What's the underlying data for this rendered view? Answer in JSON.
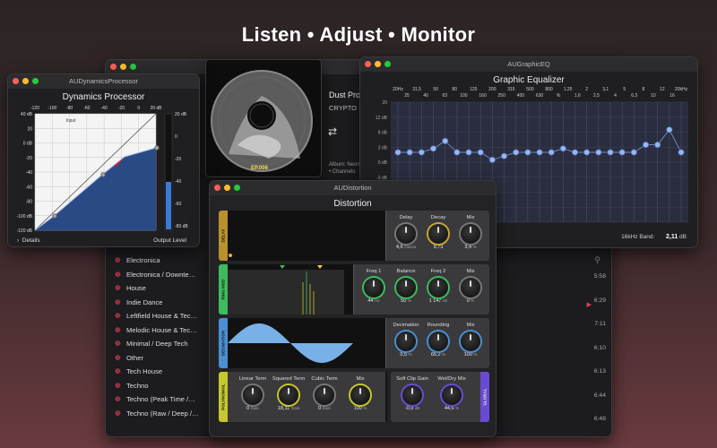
{
  "headline": "Listen • Adjust • Monitor",
  "music": {
    "genres": [
      "Electronica",
      "Electronica / Downte…",
      "House",
      "Indie Dance",
      "Leftfield House & Tec…",
      "Melodic House & Tec…",
      "Minimal / Deep Tech",
      "Other",
      "Tech House",
      "Techno",
      "Techno (Peak Time /…",
      "Techno (Raw / Deep /…"
    ],
    "times": [
      "5:58",
      "6:29",
      "7:11",
      "6:10",
      "6:13",
      "6:44",
      "6:48"
    ],
    "track_title": "Dust Pro",
    "track_artist": "CRYPTO",
    "album_line1": "Album: Neon",
    "album_line2": "• Channels:",
    "album_badge": "EP.006"
  },
  "dynamics": {
    "window_title": "AUDynamicsProcessor",
    "title": "Dynamics Processor",
    "x_ticks": [
      "-120",
      "-100",
      "-80",
      "-60",
      "-40",
      "-20",
      "0",
      "20 dB"
    ],
    "y_ticks": [
      "40 dB",
      "20",
      "0 dB",
      "-20",
      "-40",
      "-60",
      "-80",
      "-100 dB",
      "-120 dB"
    ],
    "input_label": "Input",
    "output_label": "Output",
    "meter_ticks": [
      "20 dB",
      "0",
      "-20",
      "-40",
      "-60",
      "-80 dB"
    ],
    "details_label": "Details",
    "output_level_label": "Output Level"
  },
  "geq": {
    "window_title": "AUGraphicEQ",
    "title": "Graphic Equalizer",
    "freq_top": [
      "20Hz",
      "31,5",
      "50",
      "80",
      "125",
      "200",
      "315",
      "500",
      "800",
      "1,25",
      "2",
      "3,1",
      "5",
      "8",
      "12",
      "20kHz"
    ],
    "freq_bottom": [
      "25",
      "40",
      "63",
      "100",
      "160",
      "250",
      "400",
      "630",
      "%",
      "1,6",
      "2,5",
      "4",
      "6,3",
      "10",
      "16"
    ],
    "y_ticks": [
      "20",
      "12 dB",
      "8 dB",
      "3 dB",
      "0 dB",
      "-3 dB",
      "-8 dB",
      "-12 dB",
      "-20"
    ],
    "gains_db": [
      0,
      0,
      0,
      1,
      3,
      0,
      0,
      0,
      -2,
      -1,
      0,
      0,
      0,
      0,
      1,
      0,
      0,
      0,
      0,
      0,
      0,
      2,
      2,
      6,
      0
    ],
    "band_label": "16kHz Band:",
    "band_value": "2,11",
    "band_unit": "dB"
  },
  "distortion": {
    "window_title": "AUDistortion",
    "title": "Distortion",
    "sections": [
      {
        "label": "DELAY",
        "color": "#b8902e",
        "knobs": [
          {
            "name": "Delay",
            "value": "4,6",
            "unit": "msecs",
            "ring": "#777"
          },
          {
            "name": "Decay",
            "value": "9,73",
            "unit": "",
            "ring": "#c9a633"
          },
          {
            "name": "Mix",
            "value": "3,4",
            "unit": "%",
            "ring": "#777"
          }
        ]
      },
      {
        "label": "RING MOD",
        "color": "#3ebb5c",
        "knobs": [
          {
            "name": "Freq 1",
            "value": "44",
            "unit": "Hz",
            "ring": "#3ebb5c"
          },
          {
            "name": "Balance",
            "value": "50",
            "unit": "%",
            "ring": "#3ebb5c"
          },
          {
            "name": "Freq 2",
            "value": "1 147",
            "unit": "Hz",
            "ring": "#3ebb5c"
          },
          {
            "name": "Mix",
            "value": "0",
            "unit": "%",
            "ring": "#777"
          }
        ]
      },
      {
        "label": "DECIMATION",
        "color": "#4a8fd4",
        "knobs": [
          {
            "name": "Decimation",
            "value": "0,5",
            "unit": "%",
            "ring": "#4a8fd4"
          },
          {
            "name": "Rounding",
            "value": "65,2",
            "unit": "%",
            "ring": "#4a8fd4"
          },
          {
            "name": "Mix",
            "value": "100",
            "unit": "%",
            "ring": "#4a8fd4"
          }
        ]
      },
      {
        "label": "POLYNOMIAL",
        "color": "#c7c72e",
        "knobs": [
          {
            "name": "Linear Term",
            "value": "0",
            "unit": "Gain",
            "ring": "#777"
          },
          {
            "name": "Squared Term",
            "value": "18,11",
            "unit": "Gain",
            "ring": "#c7c72e"
          },
          {
            "name": "Cubic Term",
            "value": "0",
            "unit": "Gain",
            "ring": "#777"
          },
          {
            "name": "Mix",
            "value": "100",
            "unit": "%",
            "ring": "#c7c72e"
          }
        ]
      }
    ],
    "global": {
      "label": "GLOBAL",
      "color": "#6a4ad4",
      "knobs": [
        {
          "name": "Soft Clip Gain",
          "value": "-0,9",
          "unit": "dB",
          "ring": "#6a4ad4"
        },
        {
          "name": "Wet/Dry Mix",
          "value": "44,6",
          "unit": "%",
          "ring": "#6a4ad4"
        }
      ]
    }
  }
}
